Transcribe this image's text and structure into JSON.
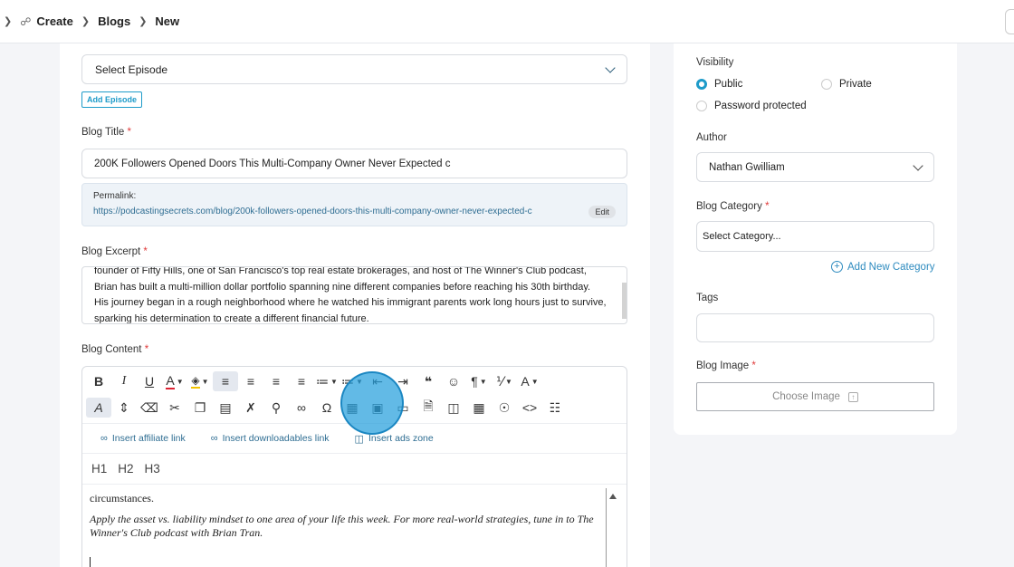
{
  "breadcrumb": {
    "items": [
      "Create",
      "Blogs",
      "New"
    ]
  },
  "episode": {
    "select_value": "Select Episode",
    "add_label": "Add Episode"
  },
  "title": {
    "label": "Blog Title",
    "required": "*",
    "value": "200K Followers Opened Doors  This Multi-Company Owner Never Expected c"
  },
  "permalink": {
    "label": "Permalink:",
    "url": "https://podcastingsecrets.com/blog/200k-followers-opened-doors-this-multi-company-owner-never-expected-c",
    "edit_label": "Edit"
  },
  "excerpt": {
    "label": "Blog Excerpt",
    "required": "*",
    "text": "founder of Fifty Hills, one of San Francisco's top real estate brokerages, and host of The Winner's Club podcast, Brian has built a multi-million dollar portfolio spanning nine different companies before reaching his 30th birthday. His journey began in a rough neighborhood where he watched his immigrant parents work long hours just to survive, sparking his determination to create a different financial future."
  },
  "content": {
    "label": "Blog Content",
    "required": "*",
    "insert_affiliate": "Insert affiliate link",
    "insert_downloadables": "Insert downloadables link",
    "insert_ads": "Insert ads zone",
    "headings": [
      "H1",
      "H2",
      "H3"
    ],
    "paragraph1": "circumstances.",
    "paragraph2": "Apply the asset vs. liability mindset to one area of your life this week. For more real-world strategies, tune in to The Winner's Club podcast with Brian Tran."
  },
  "sidebar": {
    "visibility_label": "Visibility",
    "visibility_options": [
      "Public",
      "Private",
      "Password protected"
    ],
    "visibility_selected": "Public",
    "author_label": "Author",
    "author_value": "Nathan Gwilliam",
    "category_label": "Blog Category",
    "category_required": "*",
    "category_placeholder": "Select Category...",
    "add_category_label": "Add New Category",
    "tags_label": "Tags",
    "image_label": "Blog Image",
    "image_required": "*",
    "choose_image_label": "Choose Image"
  },
  "colors": {
    "accent": "#1e9bc9",
    "link": "#2e6d92",
    "required": "#e03a3a",
    "click_marker": "#26a0dc"
  }
}
